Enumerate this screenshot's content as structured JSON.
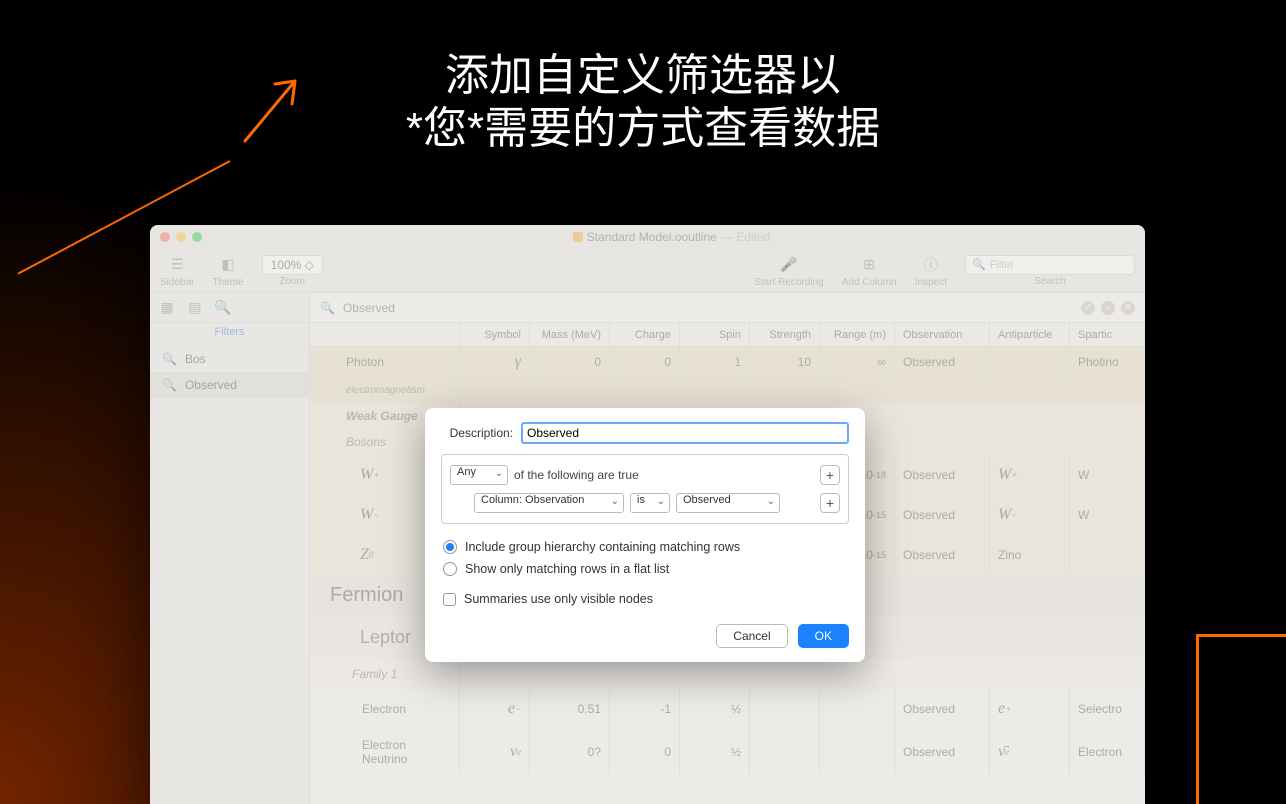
{
  "headline": {
    "line1": "添加自定义筛选器以",
    "line2": "*您*需要的方式查看数据"
  },
  "window": {
    "filename": "Standard Model.ooutline",
    "edited": "— Edited"
  },
  "toolbar": {
    "sidebar": "Sidebar",
    "theme": "Theme",
    "zoom_label": "Zoom",
    "zoom_value": "100% ◇",
    "start_recording": "Start Recording",
    "add_column": "Add Column",
    "inspect": "Inspect",
    "search_label": "Search",
    "search_placeholder": "Filter"
  },
  "sidebar": {
    "tab_label": "Filters",
    "items": [
      {
        "label": "Bos"
      },
      {
        "label": "Observed"
      }
    ]
  },
  "filterbar": {
    "name": "Observed"
  },
  "columns": {
    "symbol": "Symbol",
    "mass": "Mass (MeV)",
    "charge": "Charge",
    "spin": "Spin",
    "strength": "Strength",
    "range": "Range (m)",
    "observation": "Observation",
    "antiparticle": "Antiparticle",
    "sparticle": "Spartic"
  },
  "rows": {
    "photon": {
      "name": "Photon",
      "sym": "γ",
      "mass": "0",
      "charge": "0",
      "spin": "1",
      "strength": "10",
      "range": "∞",
      "obs": "Observed",
      "spar": "Photino"
    },
    "em": {
      "name": "electromagnetism"
    },
    "weak": {
      "name": "Weak Gauge"
    },
    "bosons": {
      "name": "Bosons"
    },
    "wp": {
      "sym": "W⁺",
      "range": "10⁻¹⁸",
      "obs": "Observed",
      "anti": "W⁺",
      "spar": "W"
    },
    "wm": {
      "sym": "W⁻",
      "range": "10⁻¹⁵",
      "obs": "Observed",
      "anti": "W⁻",
      "spar": "W"
    },
    "z0": {
      "sym": "Z⁰",
      "range": "10⁻¹⁵",
      "obs": "Observed",
      "anti": "Zino"
    },
    "fermion": {
      "name": "Fermion"
    },
    "leptor": {
      "name": "Leptor"
    },
    "fam1": {
      "name": "Family 1"
    },
    "electron": {
      "name": "Electron",
      "sym": "e⁻",
      "mass": "0.51",
      "charge": "-1",
      "spin": "½",
      "obs": "Observed",
      "anti": "e⁺",
      "spar": "Selectro"
    },
    "eneutrino": {
      "name": "Electron Neutrino",
      "sym": "νₑ",
      "mass": "0?",
      "charge": "0",
      "spin": "½",
      "obs": "Observed",
      "anti": "ν̄ₑ",
      "spar": "Electron"
    }
  },
  "dialog": {
    "desc_label": "Description:",
    "desc_value": "Observed",
    "match_selector": "Any",
    "match_text": "of the following are true",
    "rule": {
      "column": "Column: Observation",
      "op": "is",
      "value": "Observed"
    },
    "radio1": "Include group hierarchy containing matching rows",
    "radio2": "Show only matching rows in a flat list",
    "check1": "Summaries use only visible nodes",
    "cancel": "Cancel",
    "ok": "OK"
  }
}
